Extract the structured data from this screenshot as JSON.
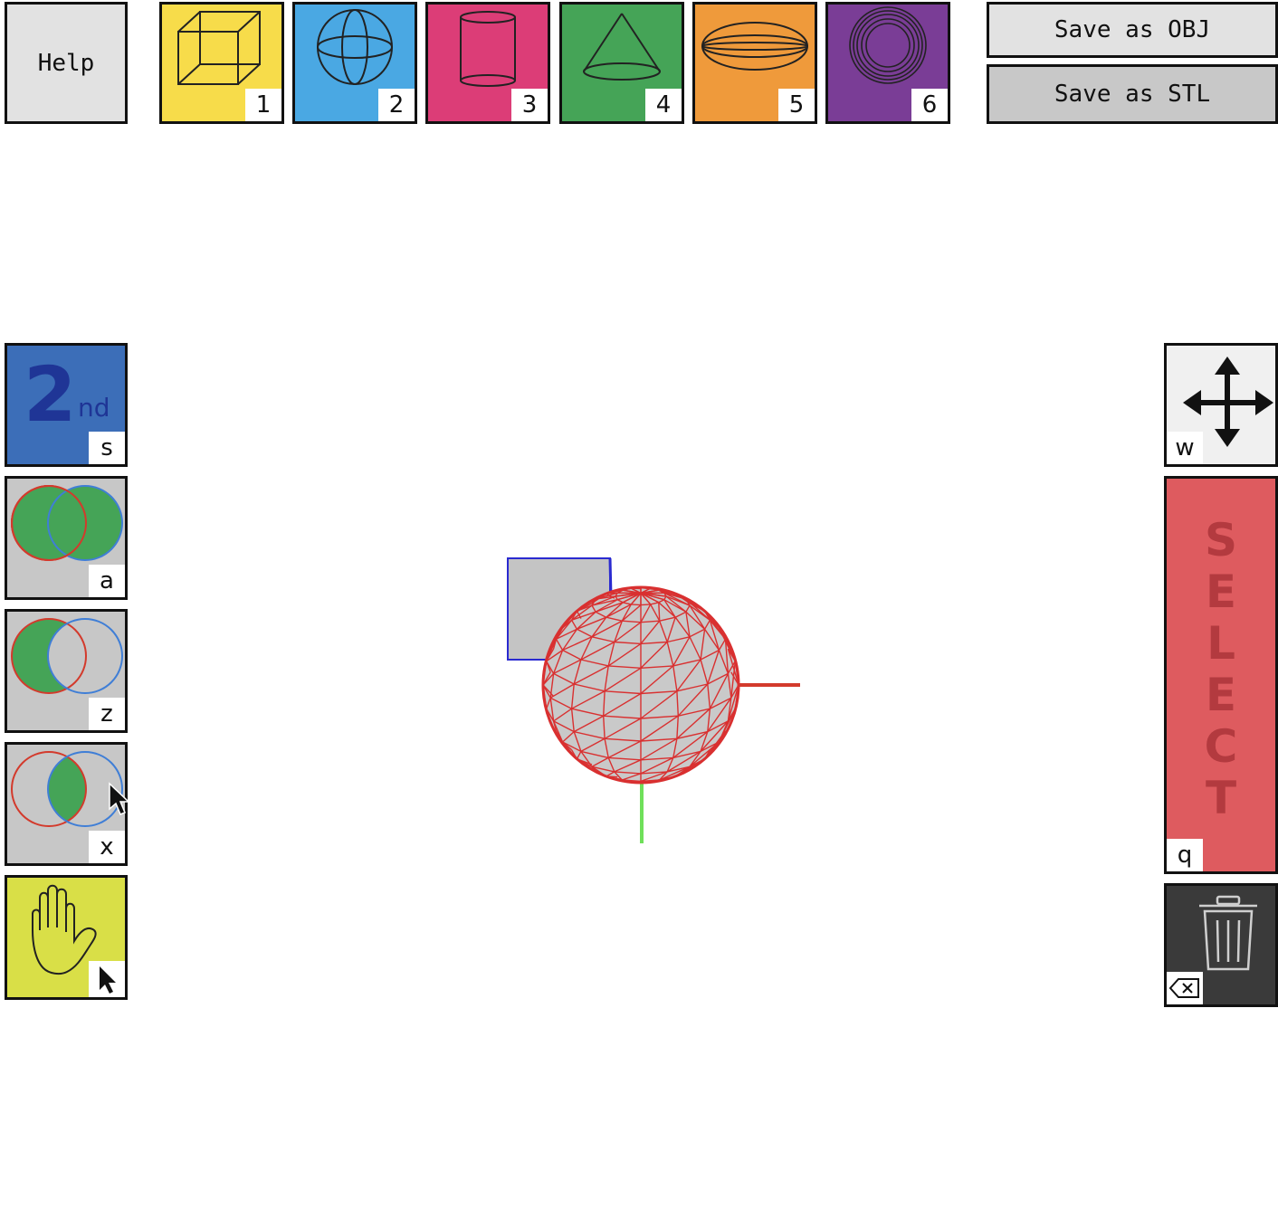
{
  "toolbar": {
    "help_label": "Help",
    "save_obj_label": "Save as OBJ",
    "save_stl_label": "Save as STL"
  },
  "shapes": [
    {
      "name": "cube",
      "icon": "cube-icon",
      "key": "1",
      "color": "#f7dc4a"
    },
    {
      "name": "sphere",
      "icon": "sphere-icon",
      "key": "2",
      "color": "#4aa8e3"
    },
    {
      "name": "cylinder",
      "icon": "cylinder-icon",
      "key": "3",
      "color": "#dc3d77"
    },
    {
      "name": "cone",
      "icon": "cone-icon",
      "key": "4",
      "color": "#45a457"
    },
    {
      "name": "ellipsoid",
      "icon": "ellipsoid-icon",
      "key": "5",
      "color": "#ef9a3b"
    },
    {
      "name": "torus",
      "icon": "torus-icon",
      "key": "6",
      "color": "#7a3d96"
    }
  ],
  "left_tools": {
    "second": {
      "big": "2",
      "small": "nd",
      "key": "s",
      "color": "#3c6eb8"
    },
    "union": {
      "icon": "union-icon",
      "key": "a",
      "color": "#c7c7c7"
    },
    "difference": {
      "icon": "difference-icon",
      "key": "z",
      "color": "#c7c7c7"
    },
    "intersection": {
      "icon": "intersection-icon",
      "key": "x",
      "color": "#c7c7c7"
    },
    "pan": {
      "icon": "hand-icon",
      "key_icon": "cursor-arrow-icon",
      "color": "#d9df47"
    }
  },
  "right_tools": {
    "move": {
      "icon": "move-arrows-icon",
      "key": "w",
      "color": "#f0f0f0"
    },
    "select": {
      "letters": [
        "S",
        "E",
        "L",
        "E",
        "C",
        "T"
      ],
      "key": "q",
      "color": "#de5b5f"
    },
    "delete": {
      "icon": "trash-icon",
      "key_icon": "backspace-icon",
      "color": "#3a3a3a"
    }
  },
  "scene": {
    "objects": [
      "cube",
      "sphere"
    ],
    "axis_colors": {
      "x": "#d33a2c",
      "y": "#6fe05a",
      "z": "#2a2ad0"
    },
    "selected_color": "#d93030"
  }
}
